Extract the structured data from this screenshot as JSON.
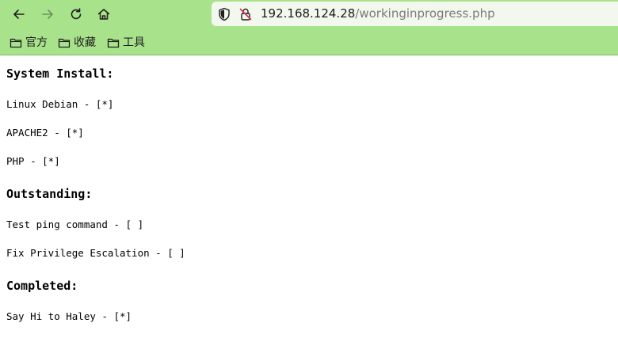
{
  "browser": {
    "url_host": "192.168.124.28",
    "url_path": "/workinginprogress.php",
    "bookmarks": [
      {
        "label": "官方"
      },
      {
        "label": "收藏"
      },
      {
        "label": "工具"
      }
    ],
    "colors": {
      "toolbar_background": "#a8e38c",
      "urlbar_background": "#f2f8ee"
    }
  },
  "page": {
    "sections": [
      {
        "heading": "System Install:",
        "items": [
          "Linux Debian - [*]",
          "APACHE2 - [*]",
          "PHP - [*]"
        ]
      },
      {
        "heading": "Outstanding:",
        "items": [
          "Test ping command - [ ]",
          "Fix Privilege Escalation - [ ]"
        ]
      },
      {
        "heading": "Completed:",
        "items": [
          "Say Hi to Haley - [*]"
        ]
      }
    ]
  }
}
